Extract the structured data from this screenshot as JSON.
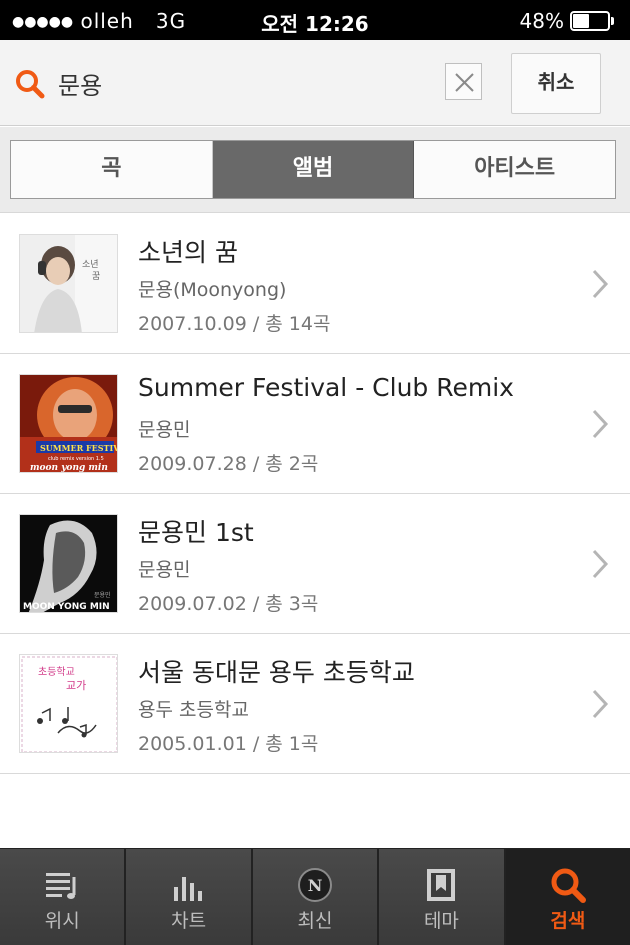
{
  "status_bar": {
    "carrier": "olleh",
    "network": "3G",
    "time": "오전 12:26",
    "battery_percent": "48%"
  },
  "search": {
    "query": "문용",
    "cancel_label": "취소",
    "accent_color": "#f05a14"
  },
  "tabs": [
    {
      "label": "곡",
      "active": false
    },
    {
      "label": "앨범",
      "active": true
    },
    {
      "label": "아티스트",
      "active": false
    }
  ],
  "albums": [
    {
      "title": "소년의 꿈",
      "artist": "문용(Moonyong)",
      "meta": "2007.10.09 / 총 14곡"
    },
    {
      "title": "Summer Festival - Club Remix",
      "artist": "문용민",
      "meta": "2009.07.28 / 총 2곡"
    },
    {
      "title": "문용민 1st",
      "artist": "문용민",
      "meta": "2009.07.02 / 총 3곡"
    },
    {
      "title": "서울 동대문 용두 초등학교",
      "artist": "용두 초등학교",
      "meta": "2005.01.01 / 총 1곡"
    }
  ],
  "bottom_nav": [
    {
      "label": "위시",
      "icon": "playlist-icon",
      "active": false
    },
    {
      "label": "차트",
      "icon": "chart-bars-icon",
      "active": false
    },
    {
      "label": "최신",
      "icon": "new-badge-icon",
      "active": false
    },
    {
      "label": "테마",
      "icon": "theme-book-icon",
      "active": false
    },
    {
      "label": "검색",
      "icon": "search-icon",
      "active": true
    }
  ]
}
